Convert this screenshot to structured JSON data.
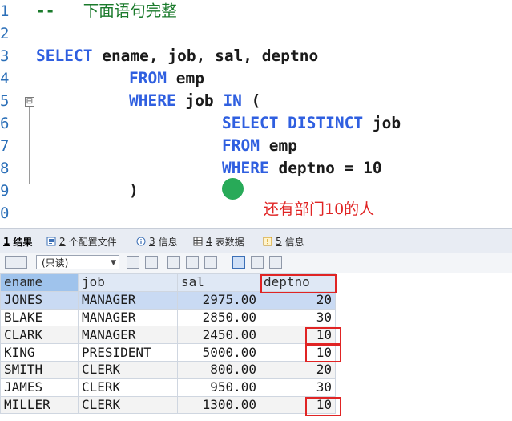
{
  "editor": {
    "line_numbers": [
      "1",
      "2",
      "3",
      "4",
      "5",
      "6",
      "7",
      "8",
      "9",
      "0"
    ],
    "line1_dashes": "--",
    "line1_comment": "下面语句完整",
    "l3_kw": "SELECT",
    "l3_rest": "ename, job, sal, deptno",
    "l4_kw": "FROM",
    "l4_rest": "emp",
    "l5_kw1": "WHERE",
    "l5_mid": "job",
    "l5_kw2": "IN",
    "l5_paren": "(",
    "l6_kw": "SELECT DISTINCT",
    "l6_rest": "job",
    "l7_kw": "FROM",
    "l7_rest": "emp",
    "l8_kw": "WHERE",
    "l8_rest": "deptno = 10",
    "l9": ")",
    "fold_symbol": "⊟",
    "annotation": "还有部门10的人"
  },
  "tabs": [
    {
      "num": "1",
      "label": "结果",
      "icon": "result-grid-icon",
      "active": true
    },
    {
      "num": "2",
      "label": "个配置文件",
      "icon": "profile-icon",
      "active": false
    },
    {
      "num": "3",
      "label": "信息",
      "icon": "info-icon",
      "active": false
    },
    {
      "num": "4",
      "label": "表数据",
      "icon": "table-data-icon",
      "active": false
    },
    {
      "num": "5",
      "label": "信息",
      "icon": "info-warning-icon",
      "active": false
    }
  ],
  "toolbar": {
    "readonly_value": "(只读)"
  },
  "results": {
    "columns": [
      "ename",
      "job",
      "sal",
      "deptno"
    ],
    "rows": [
      [
        "JONES",
        "MANAGER",
        "2975.00",
        "20"
      ],
      [
        "BLAKE",
        "MANAGER",
        "2850.00",
        "30"
      ],
      [
        "CLARK",
        "MANAGER",
        "2450.00",
        "10"
      ],
      [
        "KING",
        "PRESIDENT",
        "5000.00",
        "10"
      ],
      [
        "SMITH",
        "CLERK",
        "800.00",
        "20"
      ],
      [
        "JAMES",
        "CLERK",
        "950.00",
        "30"
      ],
      [
        "MILLER",
        "CLERK",
        "1300.00",
        "10"
      ]
    ]
  },
  "colors": {
    "keyword": "#2f5fe0",
    "comment": "#1a7a2b",
    "annotation": "#e02424",
    "selected_row": "#c9daf3"
  }
}
